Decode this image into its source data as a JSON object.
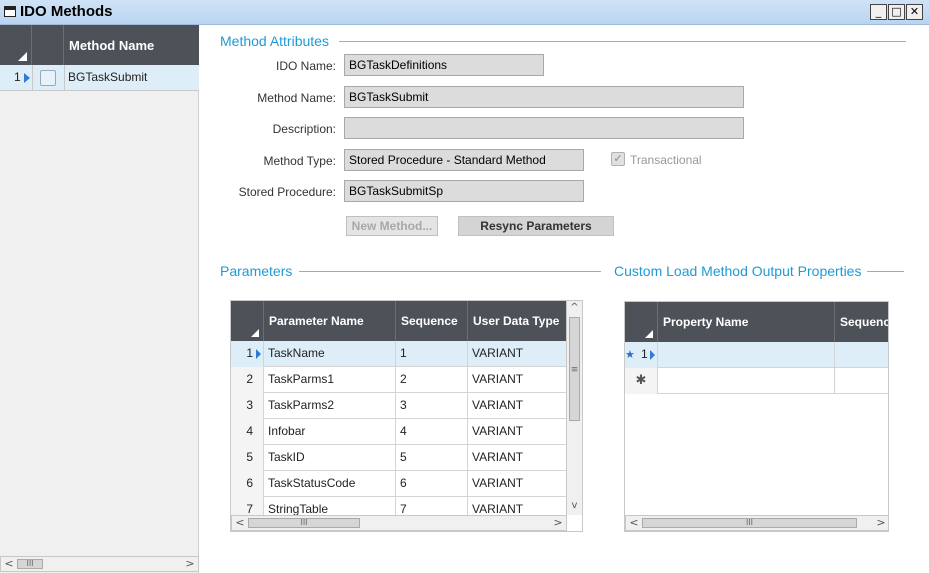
{
  "window": {
    "title": "IDO Methods",
    "minimize_glyph": "_",
    "restore_glyph": "□",
    "close_glyph": "✕"
  },
  "methods_grid": {
    "column_header": "Method Name",
    "rows": [
      {
        "num": "1",
        "name": "BGTaskSubmit"
      }
    ]
  },
  "method_attributes": {
    "section_title": "Method Attributes",
    "ido_name_label": "IDO Name:",
    "ido_name": "BGTaskDefinitions",
    "method_name_label": "Method Name:",
    "method_name": "BGTaskSubmit",
    "description_label": "Description:",
    "description": "",
    "method_type_label": "Method Type:",
    "method_type": "Stored Procedure - Standard Method",
    "transactional_label": "Transactional",
    "transactional_checked": true,
    "stored_procedure_label": "Stored Procedure:",
    "stored_procedure": "BGTaskSubmitSp",
    "new_method_button": "New Method...",
    "resync_button": "Resync Parameters"
  },
  "parameters": {
    "section_title": "Parameters",
    "columns": [
      "Parameter Name",
      "Sequence",
      "User Data Type"
    ],
    "rows": [
      {
        "num": "1",
        "name": "TaskName",
        "seq": "1",
        "type": "VARIANT"
      },
      {
        "num": "2",
        "name": "TaskParms1",
        "seq": "2",
        "type": "VARIANT"
      },
      {
        "num": "3",
        "name": "TaskParms2",
        "seq": "3",
        "type": "VARIANT"
      },
      {
        "num": "4",
        "name": "Infobar",
        "seq": "4",
        "type": "VARIANT"
      },
      {
        "num": "5",
        "name": "TaskID",
        "seq": "5",
        "type": "VARIANT"
      },
      {
        "num": "6",
        "name": "TaskStatusCode",
        "seq": "6",
        "type": "VARIANT"
      },
      {
        "num": "7",
        "name": "StringTable",
        "seq": "7",
        "type": "VARIANT"
      }
    ]
  },
  "custom_load": {
    "section_title": "Custom Load Method Output Properties",
    "columns": [
      "Property Name",
      "Sequence"
    ],
    "rows": [
      {
        "num": "1",
        "marker": "★"
      },
      {
        "num": "",
        "marker": "✱"
      }
    ]
  },
  "scroll": {
    "left_glyph": "<",
    "right_glyph": ">",
    "up_glyph": "^",
    "down_glyph": "v",
    "h_thumb_glyph": "III",
    "v_thumb_glyph": "≡"
  }
}
